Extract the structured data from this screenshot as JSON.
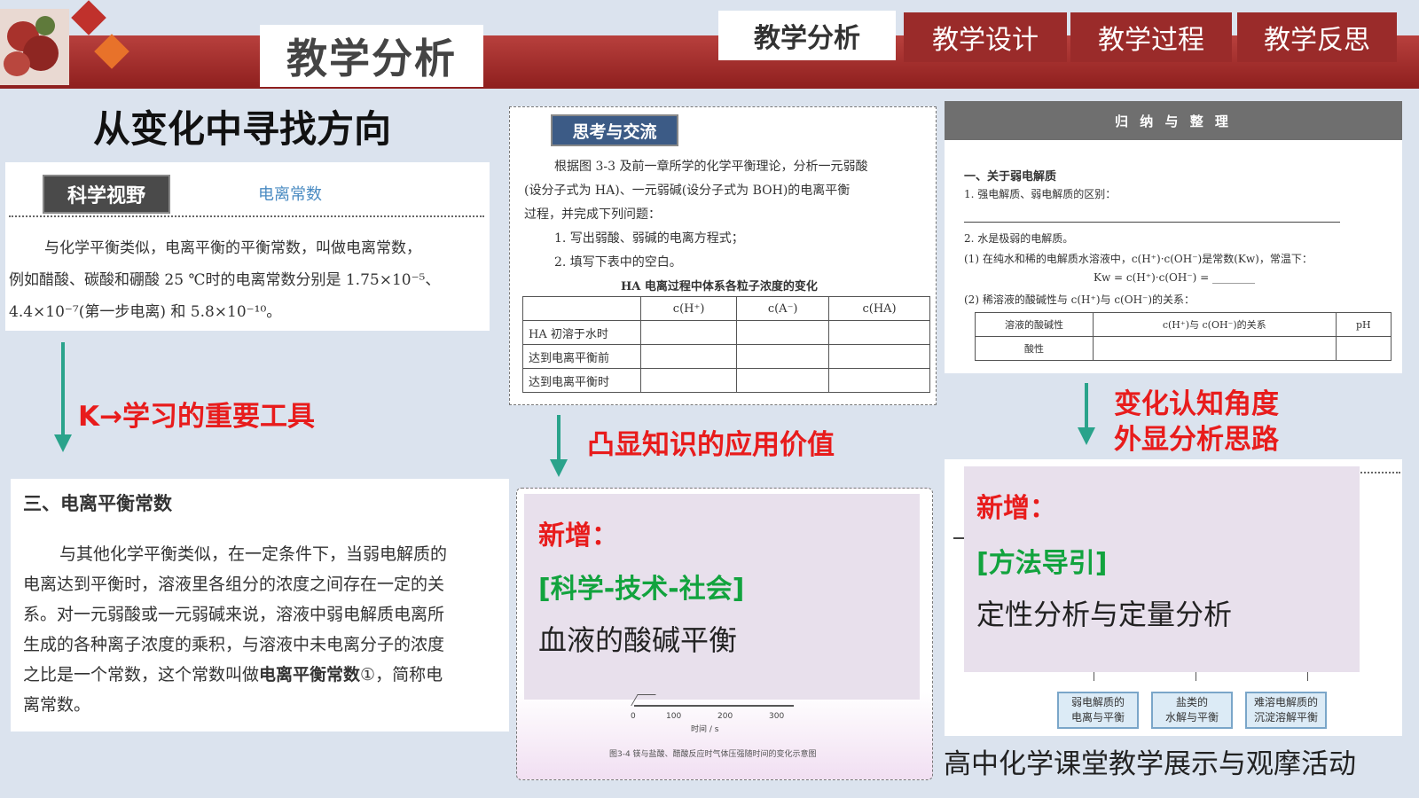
{
  "header": {
    "title": "教学分析",
    "tabs": [
      {
        "label": "教学分析",
        "active": true
      },
      {
        "label": "教学设计",
        "active": false
      },
      {
        "label": "教学过程",
        "active": false
      },
      {
        "label": "教学反思",
        "active": false
      }
    ]
  },
  "main": {
    "heading": "从变化中寻找方向"
  },
  "col1": {
    "badge": "科学视野",
    "subtitle": "电离常数",
    "scan_text_1": "与化学平衡类似，电离平衡的平衡常数，叫做电离常数，",
    "scan_text_2": "例如醋酸、碳酸和硼酸 25 ℃时的电离常数分别是 1.75×10⁻⁵、",
    "scan_text_3": "4.4×10⁻⁷(第一步电离) 和 5.8×10⁻¹⁰。",
    "arrow_label": "K→学习的重要工具",
    "new_section_title": "三、电离平衡常数",
    "new_para_1": "与其他化学平衡类似，在一定条件下，当弱电解质的",
    "new_para_2": "电离达到平衡时，溶液里各组分的浓度之间存在一定的关",
    "new_para_3": "系。对一元弱酸或一元弱碱来说，溶液中弱电解质电离所",
    "new_para_4": "生成的各种离子浓度的乘积，与溶液中未电离分子的浓度",
    "new_para_5_a": "之比是一个常数，这个常数叫做",
    "new_para_5_b": "电离平衡常数",
    "new_para_5_c": "①，简称电",
    "new_para_6": "离常数。"
  },
  "col2": {
    "badge": "思考与交流",
    "scan_text_1": "根据图 3-3 及前一章所学的化学平衡理论，分析一元弱酸",
    "scan_text_2": "(设分子式为 HA)、一元弱碱(设分子式为 BOH)的电离平衡",
    "scan_text_3": "过程，并完成下列问题：",
    "scan_item_1": "1. 写出弱酸、弱碱的电离方程式；",
    "scan_item_2": "2. 填写下表中的空白。",
    "table_caption": "HA 电离过程中体系各粒子浓度的变化",
    "table_headers": [
      "",
      "c(H⁺)",
      "c(A⁻)",
      "c(HA)"
    ],
    "table_rows": [
      "HA 初溶于水时",
      "达到电离平衡前",
      "达到电离平衡时"
    ],
    "arrow_label": "凸显知识的应用价值",
    "new_label": "新增：",
    "category": "[科学-技术-社会]",
    "topic": "血液的酸碱平衡",
    "axis_ticks": [
      "0",
      "100",
      "200",
      "300"
    ],
    "axis_unit": "时间 / s",
    "figure_caption": "图3-4  镁与盐酸、醋酸反应时气体压强随时间的变化示意图"
  },
  "col3": {
    "header": "归 纳 与 整 理",
    "section": "一、关于弱电解质",
    "q1": "1. 强电解质、弱电解质的区别：",
    "q2": "2. 水是极弱的电解质。",
    "q2_1": "(1) 在纯水和稀的电解质水溶液中，c(H⁺)·c(OH⁻)是常数(Kw)，常温下：",
    "q2_kw": "Kw = c(H⁺)·c(OH⁻) = ________",
    "q2_2": "(2) 稀溶液的酸碱性与 c(H⁺)与 c(OH⁻)的关系：",
    "table_headers": [
      "溶液的酸碱性",
      "c(H⁺)与 c(OH⁻)的关系",
      "pH"
    ],
    "table_rows": [
      "酸性"
    ],
    "arrow_label_1": "变化认知角度",
    "arrow_label_2": "外显分析思路",
    "new_label": "新增：",
    "category": "[方法导引]",
    "topic": "定性分析与定量分析",
    "chips": [
      "弱电解质的\n电离与平衡",
      "盐类的\n水解与平衡",
      "难溶电解质的\n沉淀溶解平衡"
    ]
  },
  "footer": {
    "caption": "高中化学课堂教学展示与观摩活动"
  },
  "colors": {
    "bar": "#9a2b2a",
    "arrow": "#2aa38b",
    "red": "#e81c1c",
    "green": "#12a33e",
    "background": "#dbe3ee"
  }
}
